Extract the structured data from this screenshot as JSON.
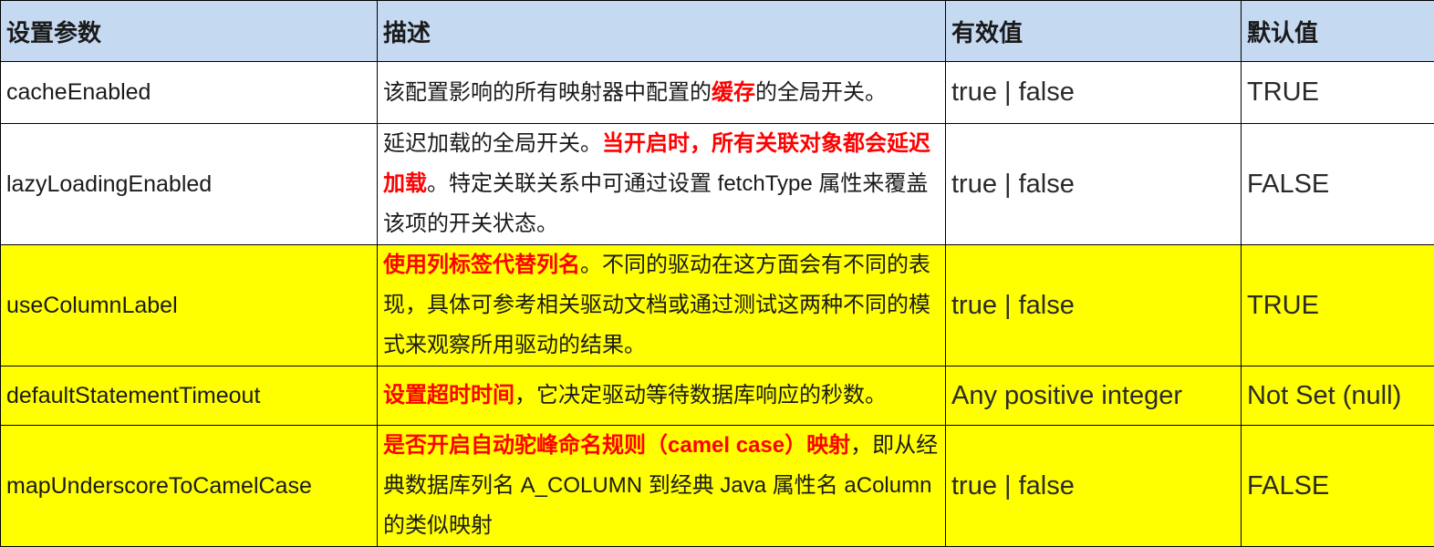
{
  "headers": {
    "param": "设置参数",
    "desc": "描述",
    "valid": "有效值",
    "default": "默认值"
  },
  "rows": [
    {
      "name": "cacheEnabled",
      "desc_pre": "该配置影响的所有映射器中配置的",
      "desc_red": "缓存",
      "desc_post": "的全局开关。",
      "valid": "true | false",
      "default": "TRUE"
    },
    {
      "name": "lazyLoadingEnabled",
      "desc_pre": "延迟加载的全局开关。",
      "desc_red": "当开启时，所有关联对象都会延迟加载",
      "desc_post": "。特定关联关系中可通过设置 fetchType 属性来覆盖该项的开关状态。",
      "valid": "true | false",
      "default": "FALSE"
    },
    {
      "name": "useColumnLabel",
      "desc_pre": "",
      "desc_red": "使用列标签代替列名",
      "desc_post": "。不同的驱动在这方面会有不同的表现，具体可参考相关驱动文档或通过测试这两种不同的模式来观察所用驱动的结果。",
      "valid": "true | false",
      "default": "TRUE"
    },
    {
      "name": "defaultStatementTimeout",
      "desc_pre": "",
      "desc_red": "设置超时时间",
      "desc_post": "，它决定驱动等待数据库响应的秒数。",
      "valid": "Any positive integer",
      "default": "Not Set (null)"
    },
    {
      "name": "mapUnderscoreToCamelCase",
      "desc_pre": "",
      "desc_red": "是否开启自动驼峰命名规则（camel case）映射",
      "desc_post": "，即从经典数据库列名 A_COLUMN 到经典 Java 属性名 aColumn 的类似映射",
      "valid": "true | false",
      "default": "FALSE"
    }
  ],
  "colors": {
    "header_bg": "#c5d9f1",
    "highlight_bg": "#ffff00",
    "emphasis_text": "#ff0000",
    "border": "#000000"
  }
}
